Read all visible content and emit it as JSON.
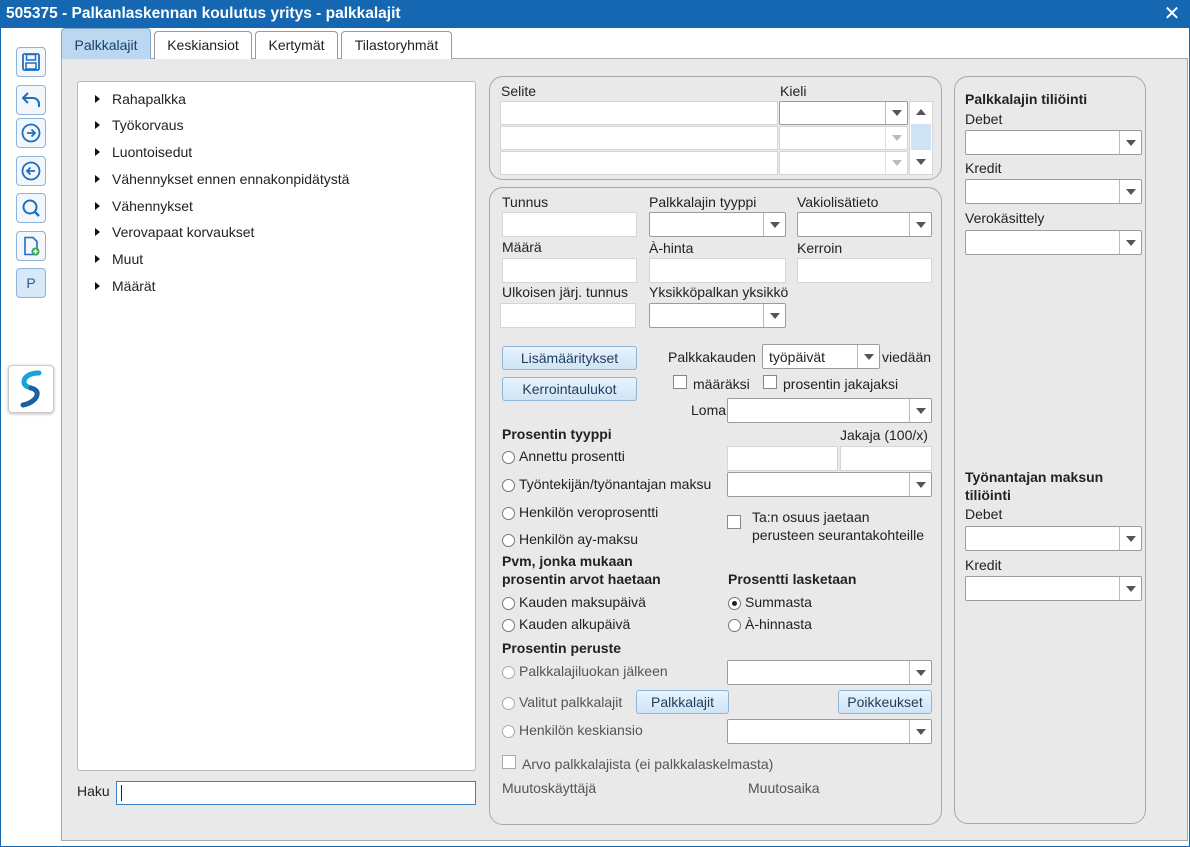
{
  "window": {
    "title": "505375 - Palkanlaskennan koulutus yritys - palkkalajit",
    "close": "✕"
  },
  "tabs": [
    {
      "label": "Palkkalajit",
      "active": true
    },
    {
      "label": "Keskiansiot"
    },
    {
      "label": "Kertymät"
    },
    {
      "label": "Tilastoryhmät"
    }
  ],
  "toolbar": {
    "icons": [
      "save-icon",
      "undo-icon",
      "arrow-right-circle-icon",
      "arrow-left-circle-icon",
      "search-icon",
      "new-document-icon"
    ],
    "p_label": "P",
    "logo_icon": "app-logo-icon"
  },
  "tree": {
    "items": [
      "Rahapalkka",
      "Työkorvaus",
      "Luontoisedut",
      "Vähennykset ennen ennakonpidätystä",
      "Vähennykset",
      "Verovapaat korvaukset",
      "Muut",
      "Määrät"
    ]
  },
  "search": {
    "label": "Haku",
    "value": ""
  },
  "selite": {
    "selite_label": "Selite",
    "kieli_label": "Kieli"
  },
  "fields": {
    "tunnus": "Tunnus",
    "palkkalajin_tyyppi": "Palkkalajin tyyppi",
    "vakiolisatieto": "Vakiolisätieto",
    "maara": "Määrä",
    "a_hinta": "À-hinta",
    "kerroin": "Kerroin",
    "ulkoisen_tunnus": "Ulkoisen järj. tunnus",
    "yksikkopalkan_yksikko": "Yksikköpalkan yksikkö"
  },
  "buttons": {
    "lisamaaritykset": "Lisämääritykset",
    "kerrointaulukot": "Kerrointaulukot",
    "palkkalajit": "Palkkalajit",
    "poikkeukset": "Poikkeukset"
  },
  "palkkakausi": {
    "label": "Palkkakauden",
    "value": "työpäivät",
    "suffix": "viedään",
    "maaraksi": "määräksi",
    "prosentin_jakajaksi": "prosentin jakajaksi",
    "loma_label": "Loma"
  },
  "prosentin_tyyppi": {
    "heading": "Prosentin tyyppi",
    "jakaja_label": "Jakaja (100/x)",
    "options": [
      "Annettu prosentti",
      "Työntekijän/työnantajan maksu",
      "Henkilön veroprosentti",
      "Henkilön ay-maksu"
    ],
    "ta_osuus_line1": "Ta:n osuus jaetaan",
    "ta_osuus_line2": "perusteen seurantakohteille"
  },
  "pvm": {
    "heading_line1": "Pvm, jonka mukaan",
    "heading_line2": "prosentin arvot haetaan",
    "options": [
      "Kauden maksupäivä",
      "Kauden alkupäivä"
    ]
  },
  "prosentti_lasketaan": {
    "heading": "Prosentti lasketaan",
    "options": [
      "Summasta",
      "À-hinnasta"
    ],
    "selected": "Summasta"
  },
  "prosentin_peruste": {
    "heading": "Prosentin peruste",
    "options": [
      "Palkkalajiluokan jälkeen",
      "Valitut palkkalajit",
      "Henkilön keskiansio"
    ]
  },
  "arvo_palkkalajista": "Arvo palkkalajista (ei palkkalaskelmasta)",
  "muutos": {
    "kayttaja": "Muutoskäyttäjä",
    "aika": "Muutosaika"
  },
  "tiliointi": {
    "heading": "Palkkalajin tiliöinti",
    "debet": "Debet",
    "kredit": "Kredit",
    "verokasittely": "Verokäsittely"
  },
  "tyonantajan_maksu": {
    "heading_line1": "Työnantajan maksun",
    "heading_line2": "tiliöinti",
    "debet": "Debet",
    "kredit": "Kredit"
  }
}
